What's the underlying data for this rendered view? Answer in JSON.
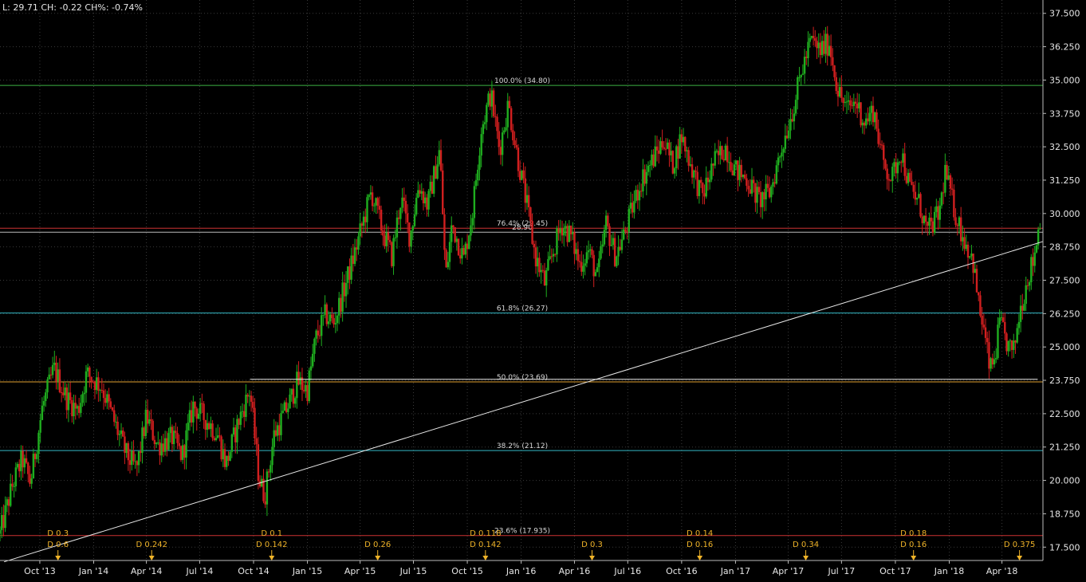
{
  "status": {
    "text": "L: 29.71 CH: -0.22 CH%: -0.74%"
  },
  "chart_data": {
    "type": "candlestick",
    "ylim": [
      17.0,
      38.0
    ],
    "xrange": [
      "2013-07-25",
      "2018-06-10"
    ],
    "yticks": [
      "17.500",
      "18.750",
      "20.000",
      "21.250",
      "22.500",
      "23.750",
      "25.000",
      "26.250",
      "27.500",
      "28.750",
      "30.000",
      "31.250",
      "32.500",
      "33.750",
      "35.000",
      "36.250",
      "37.500"
    ],
    "xticks": [
      {
        "label": "Oct '13",
        "date": "2013-10-01"
      },
      {
        "label": "Jan '14",
        "date": "2014-01-01"
      },
      {
        "label": "Apr '14",
        "date": "2014-04-01"
      },
      {
        "label": "Jul '14",
        "date": "2014-07-01"
      },
      {
        "label": "Oct '14",
        "date": "2014-10-01"
      },
      {
        "label": "Jan '15",
        "date": "2015-01-01"
      },
      {
        "label": "Apr '15",
        "date": "2015-04-01"
      },
      {
        "label": "Jul '15",
        "date": "2015-07-01"
      },
      {
        "label": "Oct '15",
        "date": "2015-10-01"
      },
      {
        "label": "Jan '16",
        "date": "2016-01-01"
      },
      {
        "label": "Apr '16",
        "date": "2016-04-01"
      },
      {
        "label": "Jul '16",
        "date": "2016-07-01"
      },
      {
        "label": "Oct '16",
        "date": "2016-10-01"
      },
      {
        "label": "Jan '17",
        "date": "2017-01-01"
      },
      {
        "label": "Apr '17",
        "date": "2017-04-01"
      },
      {
        "label": "Jul '17",
        "date": "2017-07-01"
      },
      {
        "label": "Oct '17",
        "date": "2017-10-01"
      },
      {
        "label": "Jan '18",
        "date": "2018-01-01"
      },
      {
        "label": "Apr '18",
        "date": "2018-04-01"
      }
    ],
    "fib_levels": [
      {
        "label": "100.0% (34.80)",
        "value": 34.8,
        "color": "#3cb043"
      },
      {
        "label": "76.4% (29.45)",
        "value": 29.45,
        "color": "#cc3333"
      },
      {
        "label": "61.8% (26.27)",
        "value": 26.27,
        "color": "#33b7c4"
      },
      {
        "label": "50.0% (23.69)",
        "value": 23.69,
        "color": "#e0a030"
      },
      {
        "label": "38.2% (21.12)",
        "value": 21.12,
        "color": "#33b7c4"
      },
      {
        "label": "23.6% (17.935)",
        "value": 17.935,
        "color": "#cc3333"
      }
    ],
    "extra_line": {
      "label": "28.90",
      "value": 29.3,
      "color": "#bbbbbb"
    },
    "trendline": [
      {
        "date": "2013-08-01",
        "value": 16.95
      },
      {
        "date": "2018-06-10",
        "value": 28.95
      }
    ],
    "support_line": {
      "start": "2014-09-25",
      "end": "2018-06-01",
      "value": 23.79
    },
    "dividends": [
      {
        "date": "2013-11-01",
        "labels": [
          "D 0.3",
          "D 0.6"
        ]
      },
      {
        "date": "2014-04-10",
        "labels": [
          "D 0.242"
        ]
      },
      {
        "date": "2014-11-01",
        "labels": [
          "D 0.1",
          "D 0.142"
        ]
      },
      {
        "date": "2015-05-01",
        "labels": [
          "D 0.26"
        ]
      },
      {
        "date": "2015-11-01",
        "labels": [
          "D 0.118",
          "D 0.142"
        ]
      },
      {
        "date": "2016-05-01",
        "labels": [
          "D 0.3"
        ]
      },
      {
        "date": "2016-11-01",
        "labels": [
          "D 0.14",
          "D 0.16"
        ]
      },
      {
        "date": "2017-05-01",
        "labels": [
          "D 0.34"
        ]
      },
      {
        "date": "2017-11-01",
        "labels": [
          "D 0.18",
          "D 0.16"
        ]
      },
      {
        "date": "2018-05-01",
        "labels": [
          "D 0.375"
        ]
      }
    ],
    "price_path": [
      [
        "2013-07-25",
        18.0
      ],
      [
        "2013-08-15",
        19.8
      ],
      [
        "2013-09-01",
        20.8
      ],
      [
        "2013-09-15",
        19.9
      ],
      [
        "2013-10-05",
        22.7
      ],
      [
        "2013-10-25",
        24.2
      ],
      [
        "2013-11-15",
        23.1
      ],
      [
        "2013-12-05",
        22.6
      ],
      [
        "2013-12-20",
        24.0
      ],
      [
        "2014-01-15",
        23.5
      ],
      [
        "2014-02-05",
        22.2
      ],
      [
        "2014-02-25",
        21.0
      ],
      [
        "2014-03-15",
        20.4
      ],
      [
        "2014-04-01",
        22.4
      ],
      [
        "2014-04-20",
        21.3
      ],
      [
        "2014-05-15",
        21.6
      ],
      [
        "2014-06-01",
        20.9
      ],
      [
        "2014-06-20",
        22.8
      ],
      [
        "2014-07-15",
        22.2
      ],
      [
        "2014-08-01",
        21.7
      ],
      [
        "2014-08-15",
        20.6
      ],
      [
        "2014-09-05",
        22.2
      ],
      [
        "2014-09-25",
        23.4
      ],
      [
        "2014-10-10",
        20.1
      ],
      [
        "2014-10-20",
        19.4
      ],
      [
        "2014-11-05",
        21.7
      ],
      [
        "2014-12-01",
        22.9
      ],
      [
        "2014-12-15",
        23.7
      ],
      [
        "2015-01-01",
        23.4
      ],
      [
        "2015-01-15",
        25.3
      ],
      [
        "2015-02-01",
        26.2
      ],
      [
        "2015-02-15",
        25.9
      ],
      [
        "2015-03-01",
        26.9
      ],
      [
        "2015-03-20",
        28.3
      ],
      [
        "2015-04-05",
        29.6
      ],
      [
        "2015-04-20",
        30.8
      ],
      [
        "2015-05-10",
        29.3
      ],
      [
        "2015-05-25",
        28.4
      ],
      [
        "2015-06-10",
        30.6
      ],
      [
        "2015-06-25",
        29.1
      ],
      [
        "2015-07-10",
        31.1
      ],
      [
        "2015-07-25",
        30.3
      ],
      [
        "2015-08-15",
        32.4
      ],
      [
        "2015-08-25",
        27.6
      ],
      [
        "2015-09-05",
        29.6
      ],
      [
        "2015-09-25",
        28.3
      ],
      [
        "2015-10-10",
        30.1
      ],
      [
        "2015-10-25",
        33.2
      ],
      [
        "2015-11-10",
        34.5
      ],
      [
        "2015-11-25",
        32.4
      ],
      [
        "2015-12-10",
        34.1
      ],
      [
        "2015-12-25",
        32.2
      ],
      [
        "2016-01-10",
        30.4
      ],
      [
        "2016-01-25",
        28.4
      ],
      [
        "2016-02-10",
        27.4
      ],
      [
        "2016-02-25",
        28.6
      ],
      [
        "2016-03-10",
        29.6
      ],
      [
        "2016-03-25",
        29.2
      ],
      [
        "2016-04-10",
        28.1
      ],
      [
        "2016-04-25",
        28.6
      ],
      [
        "2016-05-10",
        27.6
      ],
      [
        "2016-05-25",
        29.6
      ],
      [
        "2016-06-10",
        28.4
      ],
      [
        "2016-06-25",
        29.2
      ],
      [
        "2016-07-10",
        30.3
      ],
      [
        "2016-07-25",
        31.3
      ],
      [
        "2016-08-15",
        32.1
      ],
      [
        "2016-09-01",
        32.8
      ],
      [
        "2016-09-15",
        31.8
      ],
      [
        "2016-10-01",
        32.9
      ],
      [
        "2016-10-20",
        31.6
      ],
      [
        "2016-11-05",
        30.6
      ],
      [
        "2016-11-25",
        31.9
      ],
      [
        "2016-12-15",
        32.5
      ],
      [
        "2017-01-01",
        31.6
      ],
      [
        "2017-01-20",
        31.3
      ],
      [
        "2017-02-10",
        30.5
      ],
      [
        "2017-03-01",
        30.8
      ],
      [
        "2017-03-20",
        32.4
      ],
      [
        "2017-04-10",
        34.0
      ],
      [
        "2017-04-25",
        35.4
      ],
      [
        "2017-05-10",
        36.5
      ],
      [
        "2017-05-25",
        36.1
      ],
      [
        "2017-06-10",
        36.4
      ],
      [
        "2017-06-25",
        34.6
      ],
      [
        "2017-07-10",
        33.9
      ],
      [
        "2017-07-25",
        34.2
      ],
      [
        "2017-08-10",
        33.4
      ],
      [
        "2017-08-25",
        33.9
      ],
      [
        "2017-09-10",
        31.9
      ],
      [
        "2017-09-25",
        31.3
      ],
      [
        "2017-10-10",
        32.4
      ],
      [
        "2017-10-25",
        31.0
      ],
      [
        "2017-11-10",
        30.4
      ],
      [
        "2017-11-25",
        29.3
      ],
      [
        "2017-12-15",
        30.0
      ],
      [
        "2017-12-25",
        31.6
      ],
      [
        "2018-01-10",
        30.1
      ],
      [
        "2018-01-25",
        29.1
      ],
      [
        "2018-02-10",
        28.3
      ],
      [
        "2018-02-20",
        26.6
      ],
      [
        "2018-03-01",
        25.6
      ],
      [
        "2018-03-12",
        24.1
      ],
      [
        "2018-03-20",
        24.6
      ],
      [
        "2018-03-28",
        25.9
      ],
      [
        "2018-04-10",
        25.1
      ],
      [
        "2018-04-20",
        24.7
      ],
      [
        "2018-05-01",
        26.3
      ],
      [
        "2018-05-15",
        27.6
      ],
      [
        "2018-05-25",
        28.3
      ],
      [
        "2018-06-05",
        29.8
      ]
    ]
  }
}
